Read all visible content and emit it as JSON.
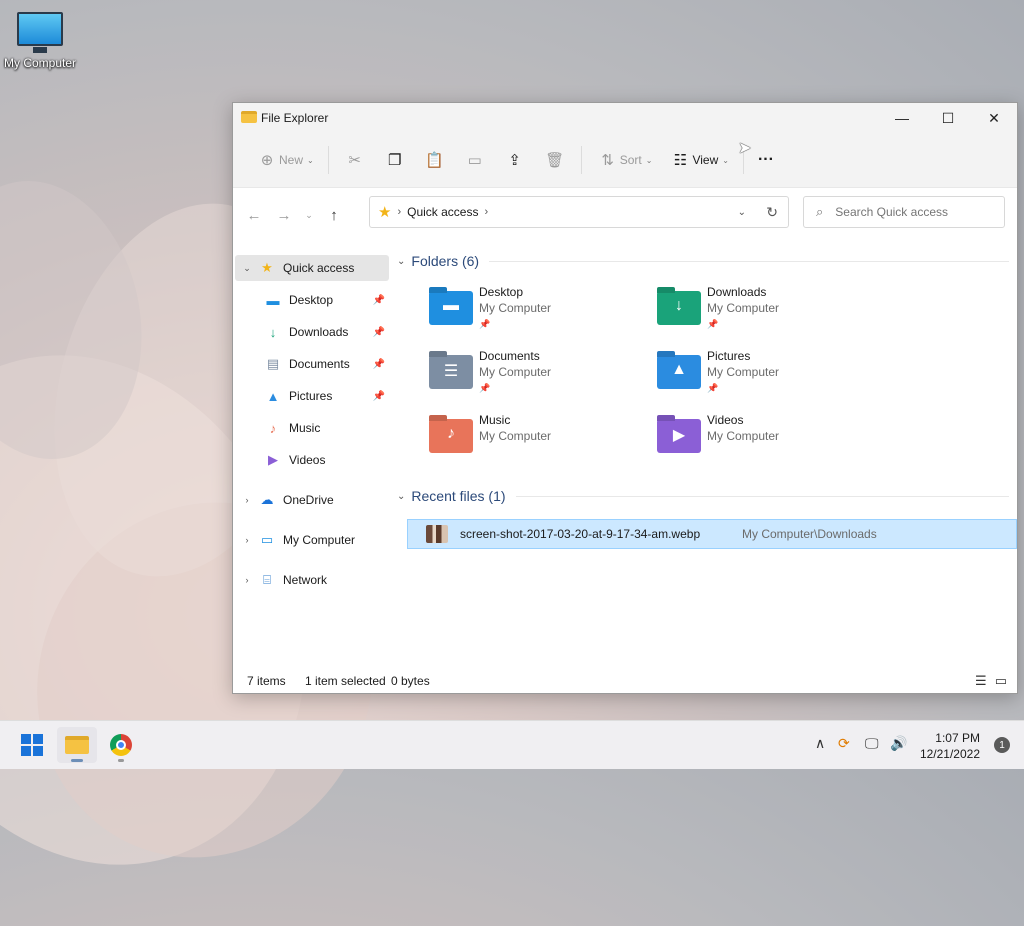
{
  "desktop": {
    "icon_label": "My Computer"
  },
  "window": {
    "title": "File Explorer"
  },
  "toolbar": {
    "new_label": "New",
    "sort_label": "Sort",
    "view_label": "View",
    "more_label": "···"
  },
  "address": {
    "path": "Quick access",
    "search_placeholder": "Search Quick access"
  },
  "sidebar": {
    "quick_access": "Quick access",
    "items": [
      {
        "label": "Desktop",
        "pinned": true
      },
      {
        "label": "Downloads",
        "pinned": true
      },
      {
        "label": "Documents",
        "pinned": true
      },
      {
        "label": "Pictures",
        "pinned": true
      },
      {
        "label": "Music",
        "pinned": false
      },
      {
        "label": "Videos",
        "pinned": false
      }
    ],
    "onedrive": "OneDrive",
    "my_computer": "My Computer",
    "network": "Network"
  },
  "folders_header": "Folders (6)",
  "folders": [
    {
      "name": "Desktop",
      "location": "My Computer",
      "color": "#1f8fe0"
    },
    {
      "name": "Downloads",
      "location": "My Computer",
      "color": "#1aa37a"
    },
    {
      "name": "Documents",
      "location": "My Computer",
      "color": "#7d8ea3"
    },
    {
      "name": "Pictures",
      "location": "My Computer",
      "color": "#2b8ce0"
    },
    {
      "name": "Music",
      "location": "My Computer",
      "color": "#e8745a"
    },
    {
      "name": "Videos",
      "location": "My Computer",
      "color": "#8b5fd6"
    }
  ],
  "recent_header": "Recent files (1)",
  "recent": [
    {
      "name": "screen-shot-2017-03-20-at-9-17-34-am.webp",
      "path": "My Computer\\Downloads"
    }
  ],
  "status": {
    "items": "7 items",
    "selected": "1 item selected",
    "size": "0 bytes"
  },
  "taskbar": {
    "time": "1:07 PM",
    "date": "12/21/2022",
    "notifications": "1"
  }
}
